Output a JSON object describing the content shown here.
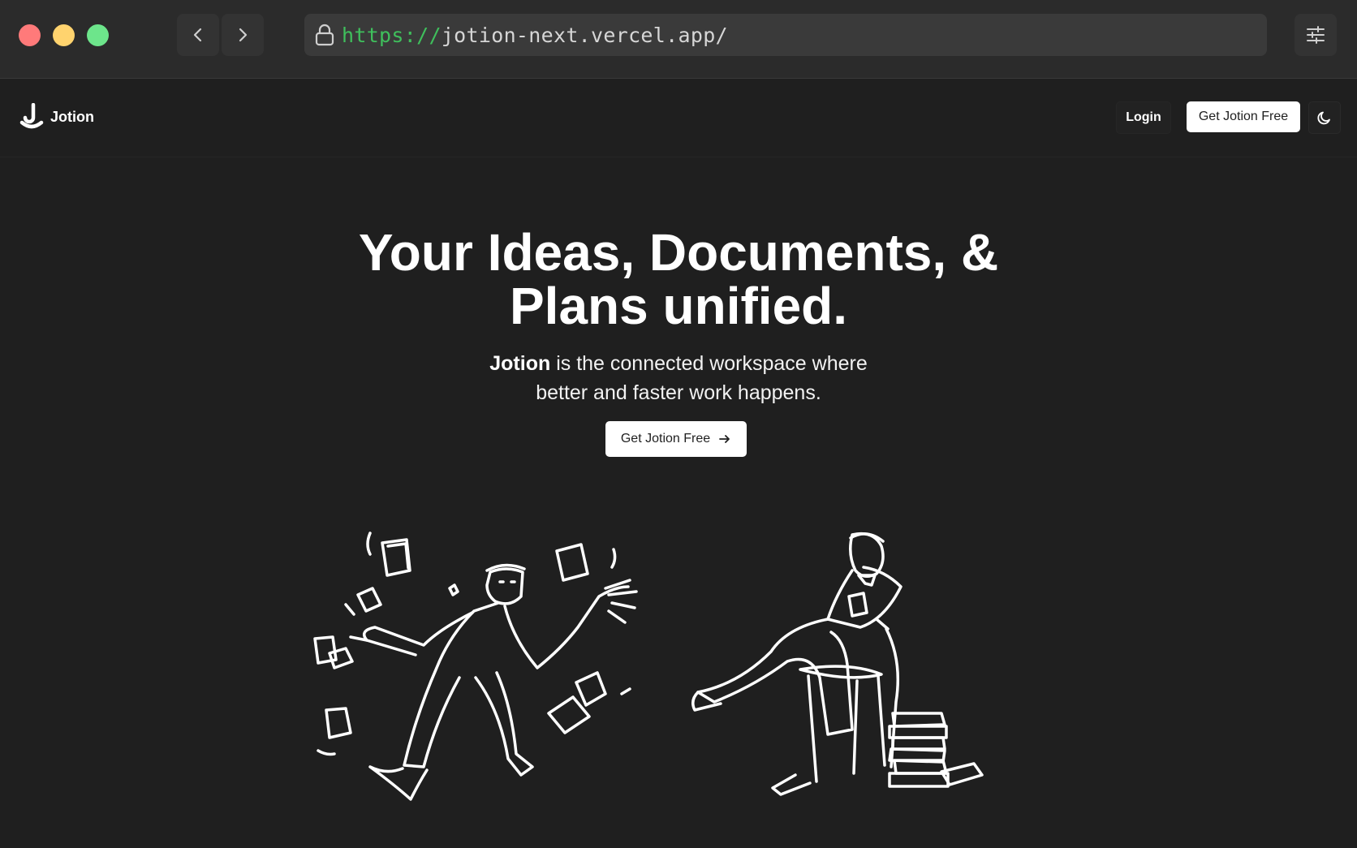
{
  "browser": {
    "url_scheme": "https://",
    "url_rest": "jotion-next.vercel.app/",
    "colors": {
      "close": "#ff7a7a",
      "minimize": "#ffd36e",
      "maximize": "#6de58b",
      "scheme": "#3fbf5c"
    }
  },
  "header": {
    "logo_text": "Jotion",
    "login_label": "Login",
    "cta_label": "Get Jotion Free"
  },
  "hero": {
    "title_line1": "Your Ideas, Documents, &",
    "title_line2": "Plans unified.",
    "subtitle_brand": "Jotion",
    "subtitle_rest": " is the connected workspace where",
    "subtitle_line2": "better and faster work happens.",
    "cta_label": "Get Jotion Free"
  },
  "icons": [
    "back-icon",
    "forward-icon",
    "lock-icon",
    "settings-sliders-icon",
    "jotion-logo-icon",
    "moon-icon",
    "arrow-right-icon"
  ]
}
